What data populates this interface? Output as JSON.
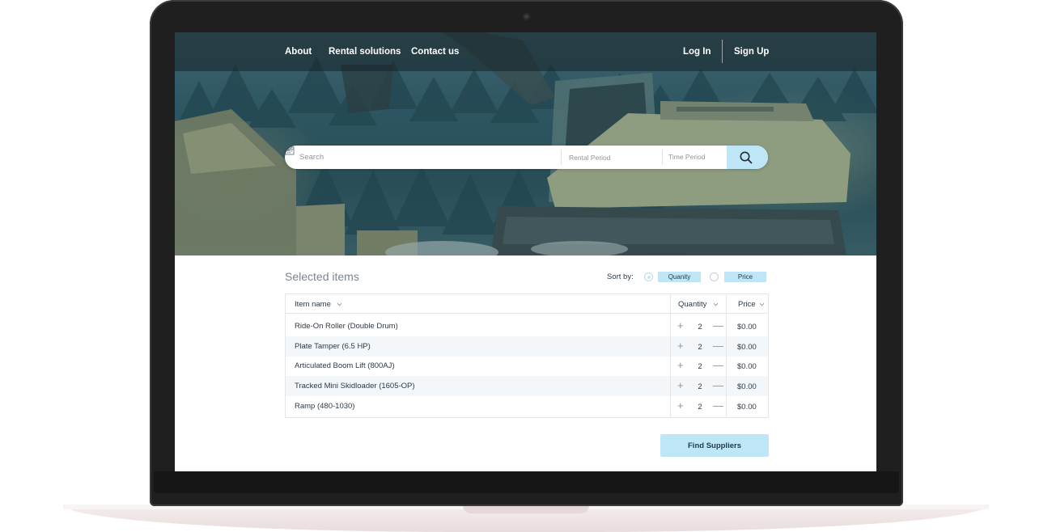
{
  "nav": {
    "links": [
      "About",
      "Rental solutions",
      "Contact us"
    ],
    "login": "Log In",
    "signup": "Sign Up"
  },
  "search": {
    "placeholder": "Search",
    "rental_period": "Rental Period",
    "time_period": "Time Period"
  },
  "selected": {
    "title": "Selected items",
    "sort_label": "Sort by:",
    "sort_options": [
      "Quanity",
      "Price"
    ],
    "sort_selected": "Quanity"
  },
  "table": {
    "columns": [
      "Item name",
      "Quantity",
      "Price"
    ],
    "rows": [
      {
        "name": "Ride-On Roller (Double Drum)",
        "qty": "2",
        "price": "$0.00"
      },
      {
        "name": "Plate Tamper (6.5 HP)",
        "qty": "2",
        "price": "$0.00"
      },
      {
        "name": "Articulated Boom Lift (800AJ)",
        "qty": "2",
        "price": "$0.00"
      },
      {
        "name": "Tracked Mini Skidloader (1605-OP)",
        "qty": "2",
        "price": "$0.00"
      },
      {
        "name": "Ramp (480-1030)",
        "qty": "2",
        "price": "$0.00"
      }
    ],
    "plus_symbol": "+",
    "minus_symbol": "—"
  },
  "actions": {
    "find_suppliers": "Find Suppliers"
  },
  "icons": {
    "search": "search-icon",
    "calendar": "calendar-icon",
    "chevron": "chevron-down-icon"
  },
  "colors": {
    "accent": "#bfe6f6",
    "hero_tint": "#2f5561",
    "text": "#2e3a46"
  }
}
